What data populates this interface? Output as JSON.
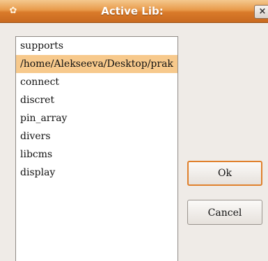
{
  "window": {
    "title": "Active Lib:",
    "close_glyph": "×",
    "app_icon": "pawprint-icon"
  },
  "list": {
    "items": [
      "supports",
      "/home/Alekseeva/Desktop/prak",
      "connect",
      "discret",
      "pin_array",
      "divers",
      "libcms",
      "display"
    ],
    "selected_index": 1
  },
  "buttons": {
    "ok_label": "Ok",
    "cancel_label": "Cancel"
  },
  "colors": {
    "titlebar": "#e89a4a",
    "selection": "#f7c98c",
    "focus_border": "#e0802c"
  }
}
